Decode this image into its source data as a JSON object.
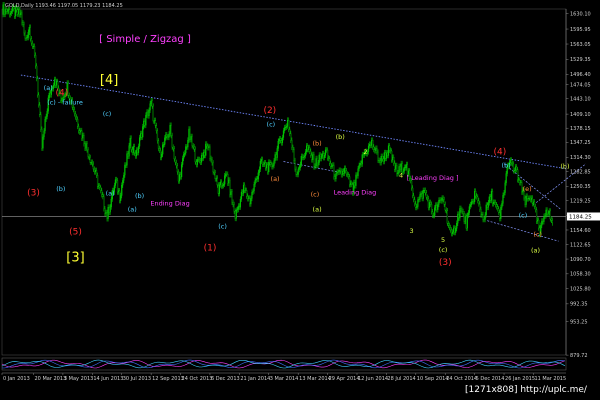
{
  "header": {
    "symbol_line": "GOLD,Daily  1193.46 1197.05 1179.23 1184.25"
  },
  "chart_data": {
    "type": "candlestick",
    "title": "[ Simple / Zigzag ]",
    "ylim": [
      880,
      1640
    ],
    "xlim": [
      0,
      537
    ],
    "price_ticks": [
      1630.1,
      1595.95,
      1563.05,
      1529.35,
      1496.4,
      1474.05,
      1443.1,
      1409.1,
      1378.15,
      1347.25,
      1314.3,
      1282.85,
      1250.35,
      1219.25,
      1186.55,
      1154.6,
      1122.65,
      1090.7,
      1058.3,
      1025.8,
      992.35,
      953.25,
      879.72
    ],
    "date_ticks": [
      {
        "i": 0,
        "label": "0 Jan 2013"
      },
      {
        "i": 30,
        "label": "20 Mar 2013"
      },
      {
        "i": 58,
        "label": "3 May 2013"
      },
      {
        "i": 86,
        "label": "14 Jun 2013"
      },
      {
        "i": 114,
        "label": "30 Jul 2013"
      },
      {
        "i": 142,
        "label": "12 Sep 2013"
      },
      {
        "i": 170,
        "label": "24 Oct 2013"
      },
      {
        "i": 198,
        "label": "6 Dec 2013"
      },
      {
        "i": 226,
        "label": "21 Jan 2014"
      },
      {
        "i": 254,
        "label": "3 Mar 2014"
      },
      {
        "i": 282,
        "label": "13 Mar 2014"
      },
      {
        "i": 310,
        "label": "29 Apr 2014"
      },
      {
        "i": 338,
        "label": "12 Jun 2014"
      },
      {
        "i": 366,
        "label": "28 Jul 2014"
      },
      {
        "i": 394,
        "label": "10 Sep 2014"
      },
      {
        "i": 422,
        "label": "24 Oct 2014"
      },
      {
        "i": 450,
        "label": "5 Dec 2014"
      },
      {
        "i": 478,
        "label": "26 Jan 2015"
      },
      {
        "i": 506,
        "label": "11 Mar 2015"
      }
    ],
    "current_price": 1184.25,
    "current_price_label": "1184.25",
    "trendline": {
      "from": {
        "i": 18,
        "p": 1495
      },
      "to": {
        "i": 537,
        "p": 1289
      }
    },
    "pivots": [
      {
        "i": 0,
        "p": 1640
      },
      {
        "i": 18,
        "p": 1628
      },
      {
        "i": 22,
        "p": 1572
      },
      {
        "i": 26,
        "p": 1600
      },
      {
        "i": 32,
        "p": 1520
      },
      {
        "i": 38,
        "p": 1335
      },
      {
        "i": 44,
        "p": 1440
      },
      {
        "i": 50,
        "p": 1490
      },
      {
        "i": 56,
        "p": 1440
      },
      {
        "i": 62,
        "p": 1470
      },
      {
        "i": 72,
        "p": 1390
      },
      {
        "i": 86,
        "p": 1300
      },
      {
        "i": 100,
        "p": 1185
      },
      {
        "i": 108,
        "p": 1260
      },
      {
        "i": 112,
        "p": 1230
      },
      {
        "i": 122,
        "p": 1345
      },
      {
        "i": 128,
        "p": 1320
      },
      {
        "i": 134,
        "p": 1380
      },
      {
        "i": 142,
        "p": 1432
      },
      {
        "i": 150,
        "p": 1320
      },
      {
        "i": 160,
        "p": 1375
      },
      {
        "i": 168,
        "p": 1262
      },
      {
        "i": 178,
        "p": 1365
      },
      {
        "i": 186,
        "p": 1300
      },
      {
        "i": 196,
        "p": 1340
      },
      {
        "i": 206,
        "p": 1240
      },
      {
        "i": 214,
        "p": 1275
      },
      {
        "i": 222,
        "p": 1185
      },
      {
        "i": 230,
        "p": 1245
      },
      {
        "i": 236,
        "p": 1218
      },
      {
        "i": 246,
        "p": 1300
      },
      {
        "i": 256,
        "p": 1290
      },
      {
        "i": 264,
        "p": 1345
      },
      {
        "i": 272,
        "p": 1395
      },
      {
        "i": 280,
        "p": 1280
      },
      {
        "i": 290,
        "p": 1335
      },
      {
        "i": 298,
        "p": 1300
      },
      {
        "i": 308,
        "p": 1325
      },
      {
        "i": 318,
        "p": 1270
      },
      {
        "i": 326,
        "p": 1285
      },
      {
        "i": 334,
        "p": 1240
      },
      {
        "i": 344,
        "p": 1320
      },
      {
        "i": 352,
        "p": 1345
      },
      {
        "i": 360,
        "p": 1305
      },
      {
        "i": 368,
        "p": 1330
      },
      {
        "i": 376,
        "p": 1280
      },
      {
        "i": 384,
        "p": 1300
      },
      {
        "i": 394,
        "p": 1210
      },
      {
        "i": 402,
        "p": 1240
      },
      {
        "i": 410,
        "p": 1190
      },
      {
        "i": 420,
        "p": 1225
      },
      {
        "i": 428,
        "p": 1135
      },
      {
        "i": 436,
        "p": 1200
      },
      {
        "i": 442,
        "p": 1170
      },
      {
        "i": 450,
        "p": 1235
      },
      {
        "i": 458,
        "p": 1180
      },
      {
        "i": 466,
        "p": 1230
      },
      {
        "i": 474,
        "p": 1180
      },
      {
        "i": 482,
        "p": 1305
      },
      {
        "i": 490,
        "p": 1280
      },
      {
        "i": 498,
        "p": 1215
      },
      {
        "i": 504,
        "p": 1230
      },
      {
        "i": 512,
        "p": 1145
      },
      {
        "i": 518,
        "p": 1205
      },
      {
        "i": 524,
        "p": 1170
      }
    ],
    "channels": [
      {
        "color": "#8899ff",
        "from": {
          "i": 462,
          "p": 1175
        },
        "to": {
          "i": 530,
          "p": 1130
        }
      },
      {
        "color": "#8899ff",
        "from": {
          "i": 478,
          "p": 1300
        },
        "to": {
          "i": 532,
          "p": 1200
        }
      },
      {
        "color": "#8899ff",
        "from": {
          "i": 268,
          "p": 1305
        },
        "to": {
          "i": 320,
          "p": 1282
        }
      },
      {
        "color": "#8899ff",
        "from": {
          "i": 506,
          "p": 1210
        },
        "to": {
          "i": 556,
          "p": 1300
        }
      }
    ],
    "labels": [
      {
        "t": "(a)",
        "i": 44,
        "p": 1462,
        "c": "#4fd0ff"
      },
      {
        "t": "(4)",
        "i": 57,
        "p": 1450,
        "c": "#ff3030"
      },
      {
        "t": "(c) - failure",
        "i": 60,
        "p": 1430,
        "c": "#4fd0ff"
      },
      {
        "t": "(3)",
        "i": 30,
        "p": 1230,
        "c": "#ff3030"
      },
      {
        "t": "(b)",
        "i": 56,
        "p": 1240,
        "c": "#4fd0ff"
      },
      {
        "t": "(5)",
        "i": 70,
        "p": 1145,
        "c": "#ff3030"
      },
      {
        "t": "[3]",
        "i": 70,
        "p": 1085,
        "c": "#ffff33"
      },
      {
        "t": "[4]",
        "i": 102,
        "p": 1475,
        "c": "#ffff33"
      },
      {
        "t": "(c)",
        "i": 100,
        "p": 1405,
        "c": "#4fd0ff"
      },
      {
        "t": "(a)",
        "i": 103,
        "p": 1230,
        "c": "#4fd0ff"
      },
      {
        "t": "(b)",
        "i": 131,
        "p": 1225,
        "c": "#4fd0ff"
      },
      {
        "t": "(a)",
        "i": 124,
        "p": 1195,
        "c": "#4fd0ff"
      },
      {
        "t": "Ending Diag",
        "i": 160,
        "p": 1208,
        "c": "#ff40ff"
      },
      {
        "t": "(1)",
        "i": 198,
        "p": 1110,
        "c": "#ff3030"
      },
      {
        "t": "(c)",
        "i": 210,
        "p": 1158,
        "c": "#4fd0ff"
      },
      {
        "t": "(2)",
        "i": 255,
        "p": 1412,
        "c": "#ff3030"
      },
      {
        "t": "(c)",
        "i": 256,
        "p": 1382,
        "c": "#4fd0ff"
      },
      {
        "t": "(a)",
        "i": 260,
        "p": 1262,
        "c": "#ff8c3c"
      },
      {
        "t": "(b)",
        "i": 300,
        "p": 1340,
        "c": "#ff8c3c"
      },
      {
        "t": "(c)",
        "i": 298,
        "p": 1228,
        "c": "#ff8c3c"
      },
      {
        "t": "(b)",
        "i": 322,
        "p": 1355,
        "c": "#ddff44"
      },
      {
        "t": "(a)",
        "i": 300,
        "p": 1195,
        "c": "#ddff44"
      },
      {
        "t": "Leading Diag",
        "i": 336,
        "p": 1232,
        "c": "#ff40ff"
      },
      {
        "t": "2",
        "i": 346,
        "p": 1322,
        "c": "#ddff44"
      },
      {
        "t": "4",
        "i": 380,
        "p": 1270,
        "c": "#ddff44"
      },
      {
        "t": "3",
        "i": 390,
        "p": 1148,
        "c": "#ddff44"
      },
      {
        "t": "[ Leading Diag ]",
        "i": 410,
        "p": 1264,
        "c": "#ff40ff"
      },
      {
        "t": "5",
        "i": 420,
        "p": 1128,
        "c": "#ddff44"
      },
      {
        "t": "(c)",
        "i": 420,
        "p": 1106,
        "c": "#ddff44"
      },
      {
        "t": "(3)",
        "i": 422,
        "p": 1078,
        "c": "#ff3030"
      },
      {
        "t": "(4)",
        "i": 474,
        "p": 1320,
        "c": "#ff3030"
      },
      {
        "t": "(b)",
        "i": 480,
        "p": 1292,
        "c": "#4fd0ff"
      },
      {
        "t": "(a)",
        "i": 508,
        "p": 1105,
        "c": "#ddff44"
      },
      {
        "t": "(c)",
        "i": 510,
        "p": 1140,
        "c": "#ff8c3c"
      },
      {
        "t": "(b)",
        "i": 536,
        "p": 1290,
        "c": "#ddff44"
      },
      {
        "t": "(c)",
        "i": 496,
        "p": 1182,
        "c": "#4fd0ff"
      },
      {
        "t": "(e)",
        "i": 500,
        "p": 1240,
        "c": "#ff8c3c"
      }
    ],
    "watermark": "[1271x808] http://uplc.me/"
  }
}
